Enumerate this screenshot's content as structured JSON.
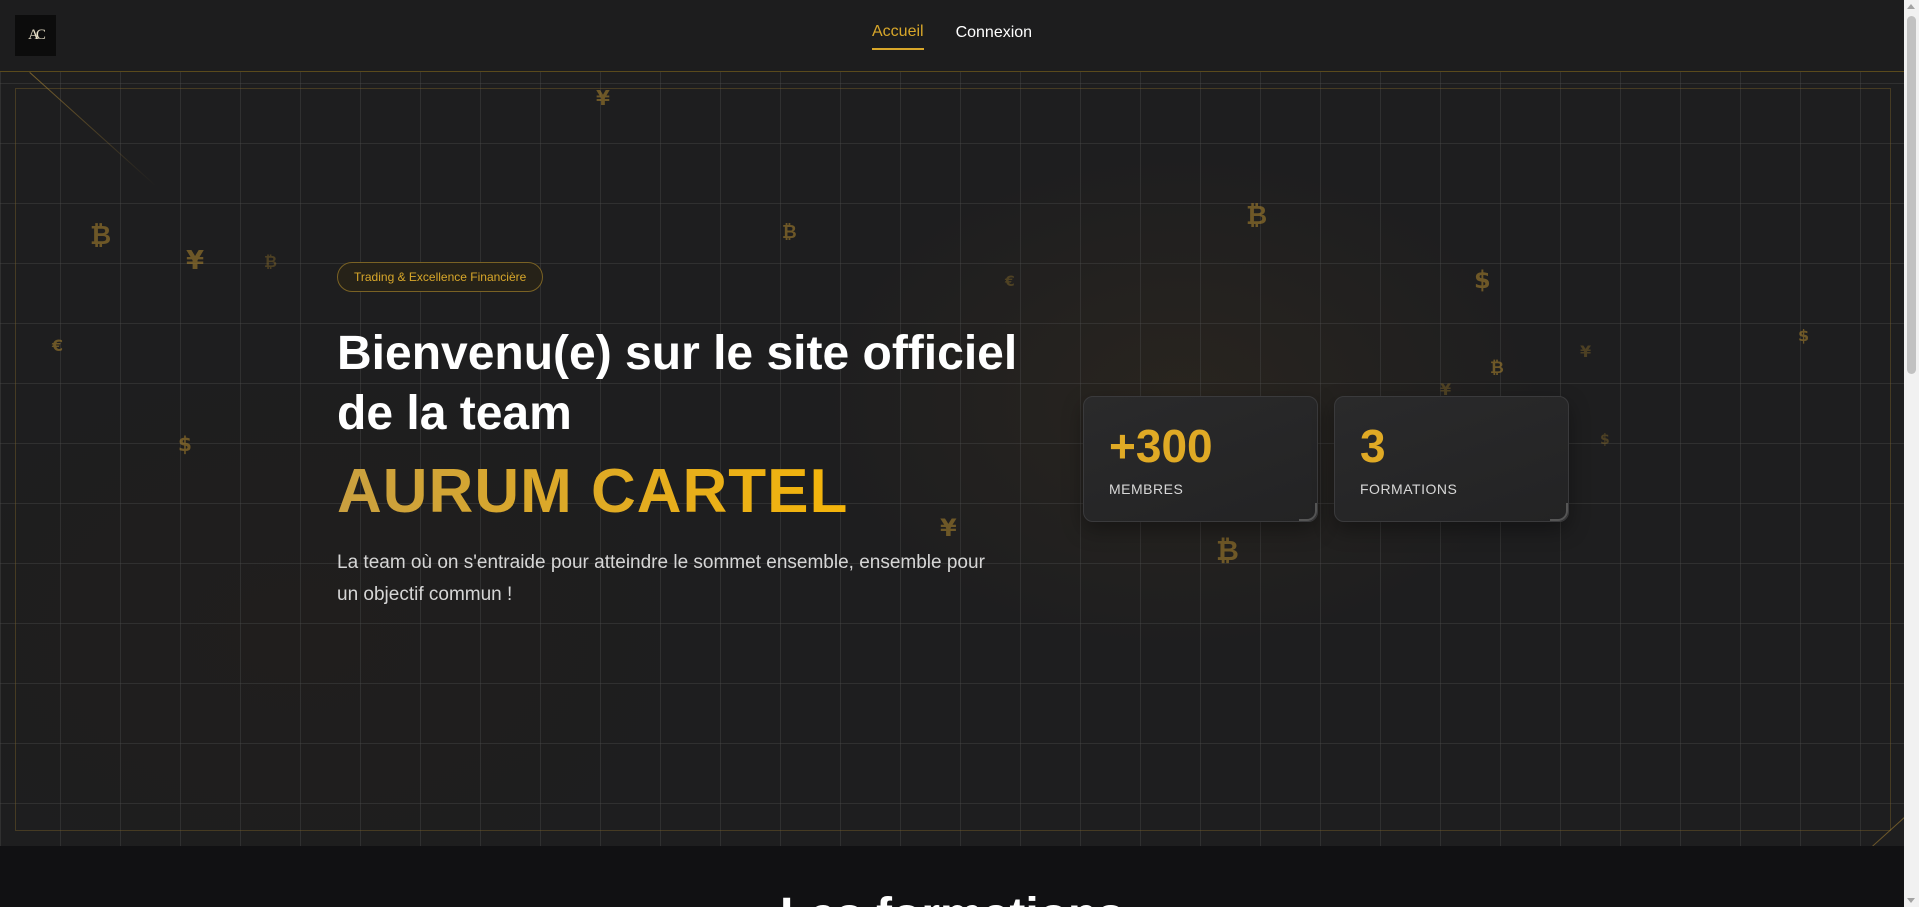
{
  "nav": {
    "logo_text": "AC",
    "links": [
      {
        "label": "Accueil",
        "active": true
      },
      {
        "label": "Connexion",
        "active": false
      }
    ]
  },
  "hero": {
    "badge": "Trading & Excellence Financière",
    "title": "Bienvenu(e) sur le site officiel de la team",
    "brand": "AURUM CARTEL",
    "subtitle": "La team où on s'entraide pour atteindre le sommet ensemble, ensemble pour un objectif commun !",
    "stats": [
      {
        "value": "+300",
        "label": "MEMBRES"
      },
      {
        "value": "3",
        "label": "FORMATIONS"
      }
    ],
    "decor_symbols": [
      "¥",
      "₿",
      "¥",
      "₿",
      "€",
      "$",
      "₿",
      "€",
      "₿",
      "$",
      "₿",
      "¥",
      "$",
      "¥",
      "$",
      "¥",
      "₿"
    ]
  },
  "next_section": {
    "title_partial": "Les formations"
  },
  "colors": {
    "accent_gold": "#d8a72a",
    "brand_gold": "#f5b50a",
    "background": "#1e1e1f",
    "navbar": "#1d1d1e"
  }
}
